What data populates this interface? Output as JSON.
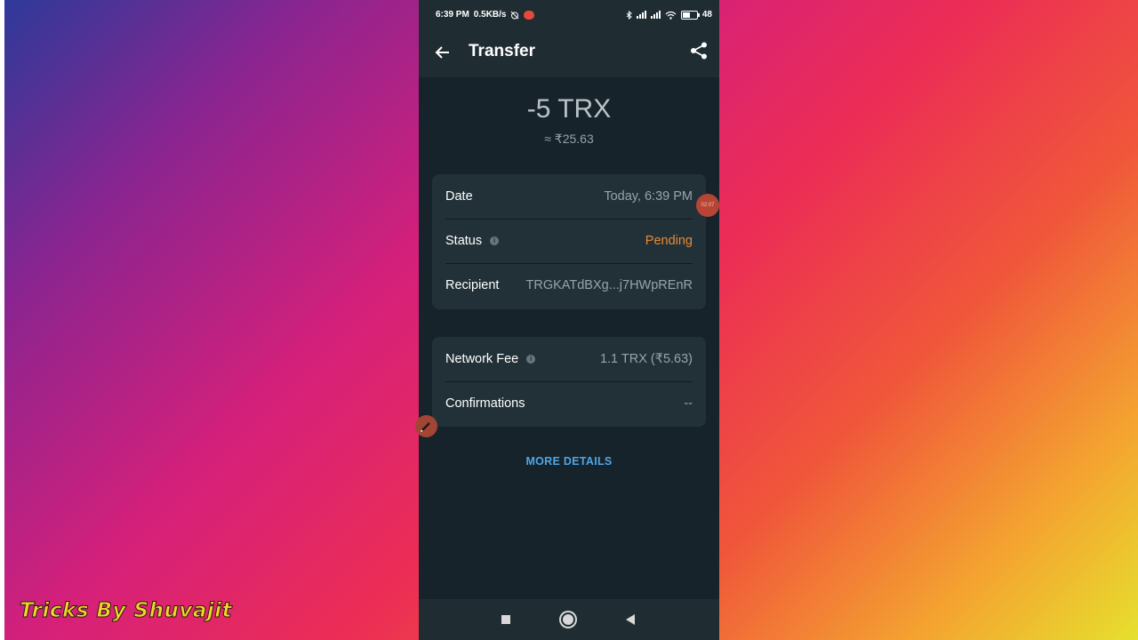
{
  "status_bar": {
    "time": "6:39 PM",
    "speed": "0.5KB/s",
    "battery": "48"
  },
  "app_bar": {
    "title": "Transfer",
    "back_icon": "arrow-left-icon",
    "share_icon": "share-icon"
  },
  "transaction": {
    "amount": "-5 TRX",
    "fiat_value": "≈ ₹25.63"
  },
  "details_card": {
    "rows": [
      {
        "label": "Date",
        "value": "Today, 6:39 PM"
      },
      {
        "label": "Status",
        "value": "Pending"
      },
      {
        "label": "Recipient",
        "value": "TRGKATdBXg...j7HWpREnR"
      }
    ]
  },
  "fee_card": {
    "rows": [
      {
        "label": "Network Fee",
        "value": "1.1 TRX (₹5.63)"
      },
      {
        "label": "Confirmations",
        "value": "--"
      }
    ]
  },
  "more_details_label": "MORE DETAILS",
  "overlay": {
    "timer": "02:07"
  },
  "watermark": "Tricks By Shuvajit",
  "colors": {
    "pending": "#e68a33",
    "link": "#4ea5e8",
    "screen_bg": "#17232a",
    "card_bg": "#223138"
  }
}
